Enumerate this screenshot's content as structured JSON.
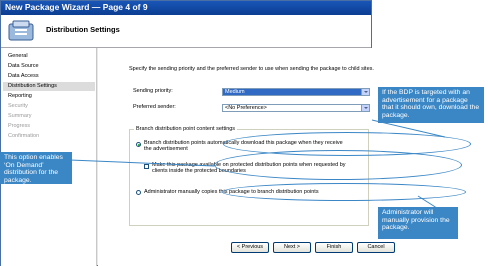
{
  "window": {
    "title": "New Package Wizard — Page 4 of 9"
  },
  "header": {
    "title": "Distribution Settings",
    "icon": "wizard-package-icon"
  },
  "nav": {
    "items": [
      {
        "label": "General",
        "state": "normal"
      },
      {
        "label": "Data Source",
        "state": "normal"
      },
      {
        "label": "Data Access",
        "state": "normal"
      },
      {
        "label": "Distribution Settings",
        "state": "active"
      },
      {
        "label": "Reporting",
        "state": "normal"
      },
      {
        "label": "Security",
        "state": "disabled"
      },
      {
        "label": "Summary",
        "state": "disabled"
      },
      {
        "label": "Progress",
        "state": "disabled"
      },
      {
        "label": "Confirmation",
        "state": "disabled"
      }
    ]
  },
  "main": {
    "description": "Specify the sending priority and the preferred sender to use when sending the package to child sites.",
    "sending_priority": {
      "label": "Sending priority:",
      "value": "Medium"
    },
    "preferred_sender": {
      "label": "Preferred sender:",
      "value": "<No Preference>"
    },
    "branch_group": {
      "title": "Branch distribution point content settings",
      "option_auto": "Branch distribution points automatically download this package when they receive the advertisement",
      "option_auto_checked": true,
      "checkbox_on_demand": "Make this package available on protected distribution points when requested by clients inside the protected boundaries",
      "checkbox_on_demand_checked": false,
      "option_manual": "Administrator manually copies this package to branch distribution points",
      "option_manual_checked": false
    }
  },
  "buttons": {
    "previous": "< Previous",
    "next": "Next >",
    "finish": "Finish",
    "cancel": "Cancel"
  },
  "callouts": {
    "top_right": "If the BDP is targeted with an advertisement for a package that it should own, download the package.",
    "left": "This option enables ‘On Demand’ distribution for the package.",
    "bottom_right": "Administrator will manually provision the package."
  },
  "colors": {
    "callout_blue": "#3b87c6",
    "title_bar": "#0b3d91",
    "selection": "#316ac5"
  }
}
